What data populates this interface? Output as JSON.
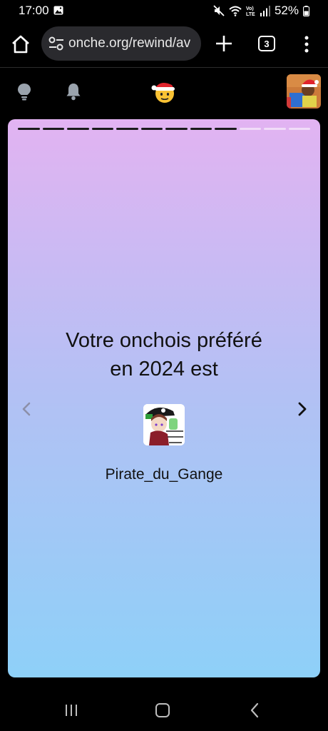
{
  "status_bar": {
    "time": "17:00",
    "battery": "52%",
    "icons": [
      "photo-icon",
      "mute-icon",
      "wifi-icon",
      "volte-icon",
      "signal-icon",
      "battery-icon"
    ]
  },
  "browser": {
    "url": "onche.org/rewind/av",
    "tab_count": "3",
    "icons": [
      "home-icon",
      "site-settings-icon",
      "plus-icon",
      "tabs-icon",
      "more-vert-icon"
    ]
  },
  "site_header": {
    "icons": [
      "lightbulb-icon",
      "bell-icon",
      "santa-smiley-logo",
      "user-avatar"
    ]
  },
  "story": {
    "progress_total": 12,
    "progress_done": 9,
    "title_line1": "Votre onchois préféré",
    "title_line2": "en 2024 est",
    "favorite_name": "Pirate_du_Gange",
    "colors": {
      "gradient_top": "#e2b3f2",
      "gradient_bottom": "#8ed0f8",
      "text": "#111111"
    }
  },
  "android_nav": {
    "icons": [
      "recent-apps-icon",
      "home-nav-icon",
      "back-nav-icon"
    ]
  }
}
